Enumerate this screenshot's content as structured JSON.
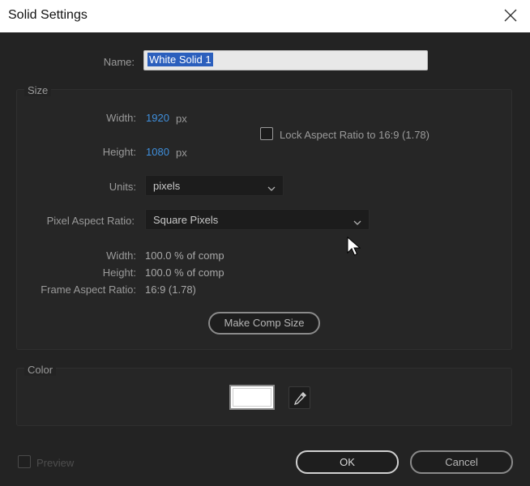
{
  "window": {
    "title": "Solid Settings",
    "close_icon": "close-icon"
  },
  "name": {
    "label": "Name:",
    "value": "White Solid 1"
  },
  "size": {
    "group_title": "Size",
    "width_label": "Width:",
    "width_value": "1920",
    "width_unit": "px",
    "height_label": "Height:",
    "height_value": "1080",
    "height_unit": "px",
    "lock_label": "Lock Aspect Ratio to 16:9 (1.78)",
    "lock_checked": false,
    "units_label": "Units:",
    "units_value": "pixels",
    "par_label": "Pixel Aspect Ratio:",
    "par_value": "Square Pixels",
    "info": {
      "width_label": "Width:",
      "width_value": "100.0 % of comp",
      "height_label": "Height:",
      "height_value": "100.0 % of comp",
      "far_label": "Frame Aspect Ratio:",
      "far_value": "16:9 (1.78)"
    },
    "make_comp_size": "Make Comp Size"
  },
  "color": {
    "group_title": "Color",
    "swatch_color": "#ffffff",
    "eyedropper_icon": "eyedropper-icon"
  },
  "footer": {
    "preview_label": "Preview",
    "preview_checked": false,
    "ok_label": "OK",
    "cancel_label": "Cancel"
  },
  "colors": {
    "background": "#232323",
    "accent_blue": "#3f8fdc",
    "selection": "#2b5fbd"
  }
}
